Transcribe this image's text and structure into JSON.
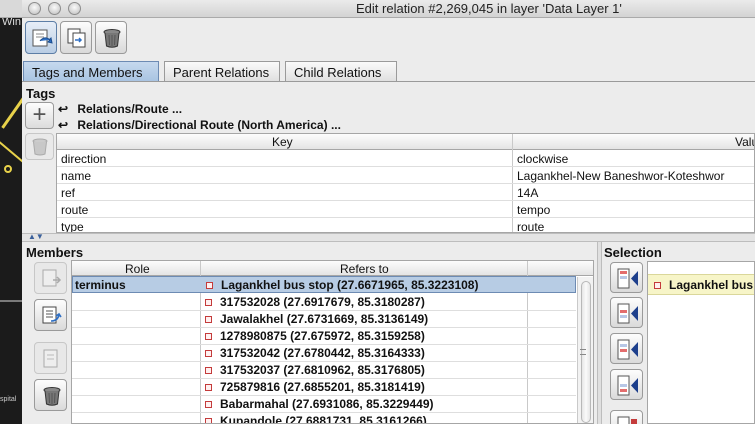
{
  "window": {
    "title": "Edit relation #2,269,045 in layer 'Data Layer 1'",
    "background_map_text": "Win",
    "background_map_small_text": "spital"
  },
  "toolbar": {
    "buttons": [
      {
        "name": "apply-changes",
        "icon": "apply-icon"
      },
      {
        "name": "duplicate-relation",
        "icon": "duplicate-icon"
      },
      {
        "name": "delete-relation",
        "icon": "trash-icon"
      }
    ]
  },
  "tabs": [
    {
      "label": "Tags and Members",
      "active": true
    },
    {
      "label": "Parent Relations",
      "active": false
    },
    {
      "label": "Child Relations",
      "active": false
    }
  ],
  "tags": {
    "label": "Tags",
    "presets": [
      {
        "label": "Relations/Route ..."
      },
      {
        "label": "Relations/Directional Route (North America) ..."
      }
    ],
    "columns": {
      "key": "Key",
      "value": "Value"
    },
    "rows": [
      {
        "key": "direction",
        "value": "clockwise"
      },
      {
        "key": "name",
        "value": "Lagankhel-New Baneshwor-Koteshwor"
      },
      {
        "key": "ref",
        "value": "14A"
      },
      {
        "key": "route",
        "value": "tempo"
      },
      {
        "key": "type",
        "value": "route"
      }
    ]
  },
  "members": {
    "label": "Members",
    "columns": {
      "role": "Role",
      "refers_to": "Refers to"
    },
    "rows": [
      {
        "role": "terminus",
        "refers_to": "Lagankhel bus stop (27.6671965, 85.3223108)",
        "selected": true
      },
      {
        "role": "",
        "refers_to": "317532028 (27.6917679, 85.3180287)"
      },
      {
        "role": "",
        "refers_to": "Jawalakhel (27.6731669, 85.3136149)"
      },
      {
        "role": "",
        "refers_to": "1278980875 (27.675972, 85.3159258)"
      },
      {
        "role": "",
        "refers_to": "317532042 (27.6780442, 85.3164333)"
      },
      {
        "role": "",
        "refers_to": "317532037 (27.6810962, 85.3176805)"
      },
      {
        "role": "",
        "refers_to": "725879816 (27.6855201, 85.3181419)"
      },
      {
        "role": "",
        "refers_to": "Babarmahal (27.6931086, 85.3229449)"
      },
      {
        "role": "",
        "refers_to": "Kupandole (27.6881731, 85.3161266)"
      }
    ]
  },
  "selection": {
    "label": "Selection",
    "items": [
      {
        "label": "Lagankhel bus stop"
      }
    ]
  },
  "colors": {
    "active_tab": "#b7cce4",
    "selected_row": "#b7cce4",
    "selection_item": "#f7f5c8",
    "node_icon": "#c43b3b"
  }
}
